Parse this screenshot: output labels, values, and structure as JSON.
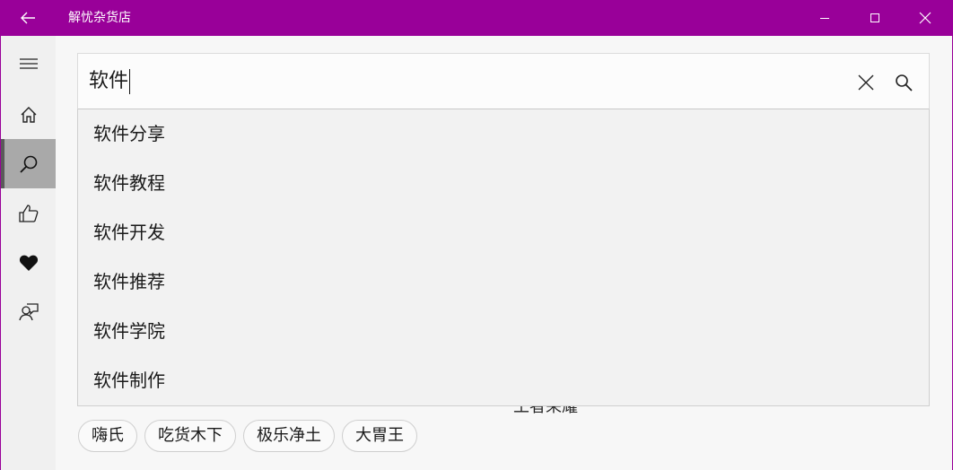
{
  "window": {
    "title": "解忧杂货店",
    "accent": "#990099"
  },
  "nav_rail": {
    "items": [
      {
        "icon": "hamburger-icon"
      },
      {
        "icon": "home-icon"
      },
      {
        "icon": "search-icon",
        "selected": true
      },
      {
        "icon": "thumbs-up-icon"
      },
      {
        "icon": "heart-icon"
      },
      {
        "icon": "person-chat-icon"
      }
    ]
  },
  "search": {
    "query": "软件"
  },
  "suggestions": [
    "软件分享",
    "软件教程",
    "软件开发",
    "软件推荐",
    "软件学院",
    "软件制作"
  ],
  "behind_text": "王者荣耀",
  "tags": [
    "嗨氏",
    "吃货木下",
    "极乐净土",
    "大胃王"
  ]
}
